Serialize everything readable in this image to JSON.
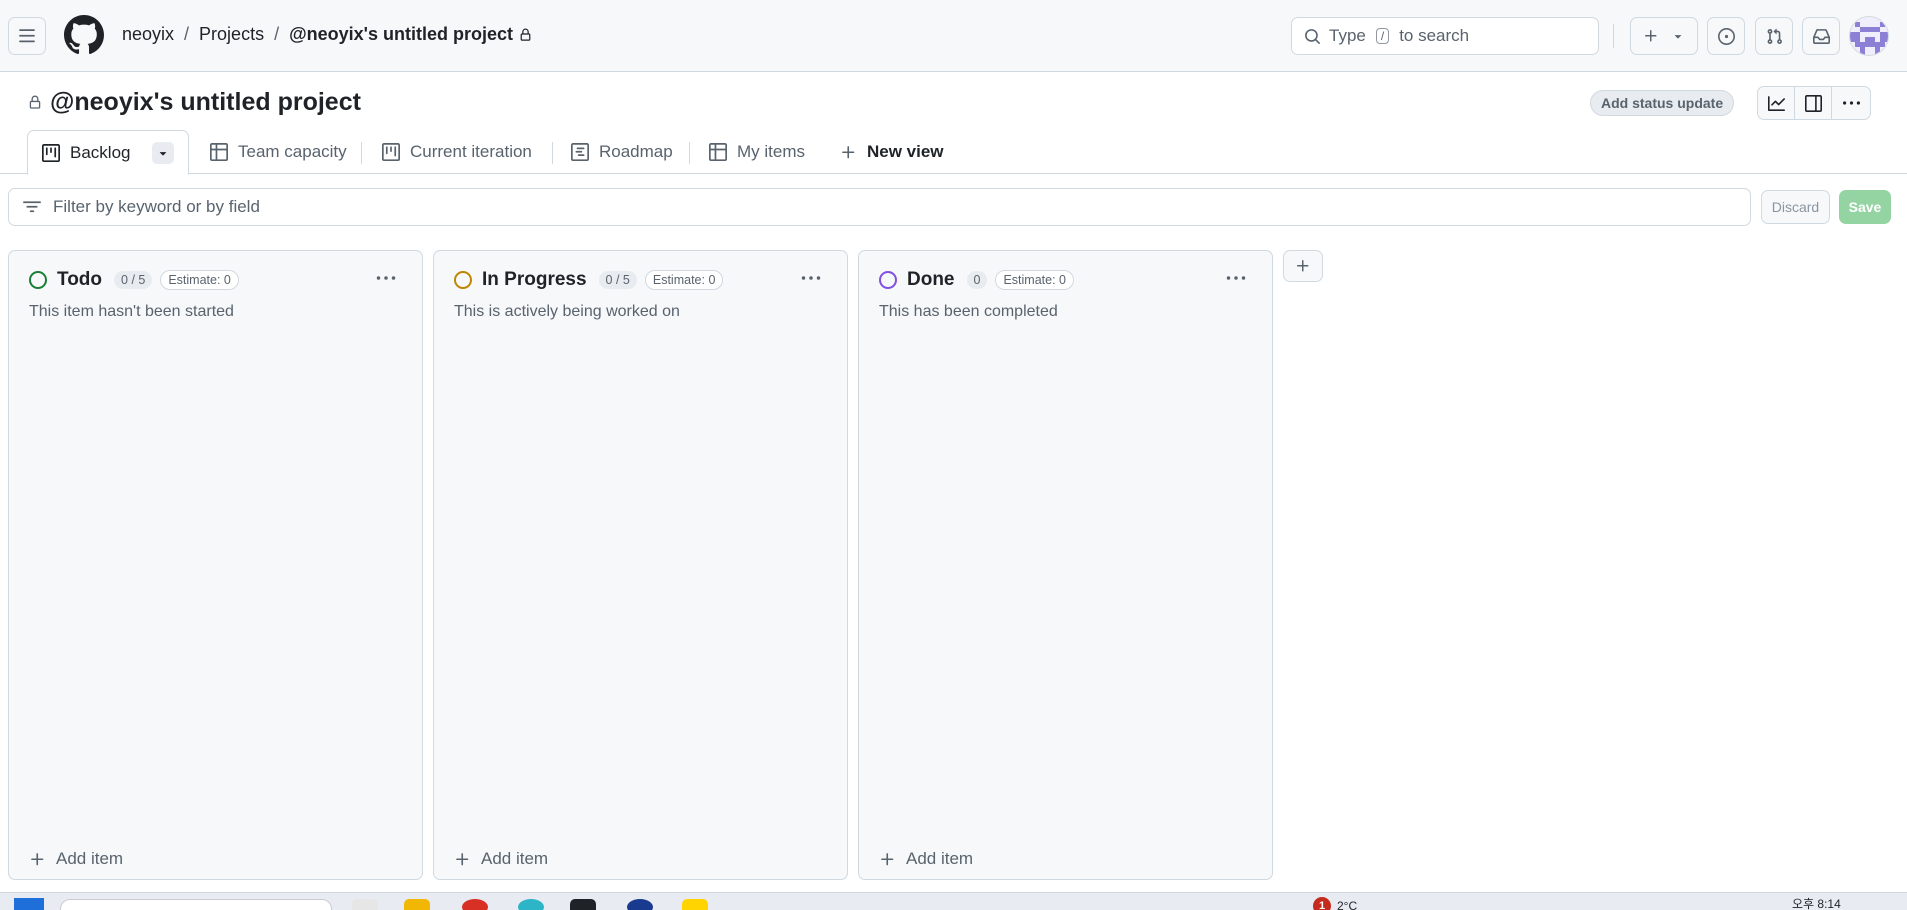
{
  "header": {
    "breadcrumb": {
      "owner": "neoyix",
      "separator": "/",
      "section": "Projects",
      "project": "@neoyix's untitled project"
    },
    "search": {
      "prefix": "Type",
      "key": "/",
      "suffix": "to search"
    },
    "icons": [
      "menu-icon",
      "github-logo-icon",
      "lock-icon",
      "search-icon",
      "plus-icon",
      "triangle-down-icon",
      "issue-opened-icon",
      "git-pull-request-icon",
      "inbox-icon"
    ]
  },
  "project": {
    "title": "@neoyix's untitled project",
    "status_update_label": "Add status update",
    "toolbar_icons": [
      "graph-icon",
      "sidebar-icon",
      "kebab-horizontal-icon"
    ]
  },
  "tabs": {
    "items": [
      {
        "label": "Backlog",
        "icon": "project-board-icon",
        "active": true
      },
      {
        "label": "Team capacity",
        "icon": "table-icon"
      },
      {
        "label": "Current iteration",
        "icon": "project-board-icon"
      },
      {
        "label": "Roadmap",
        "icon": "roadmap-icon"
      },
      {
        "label": "My items",
        "icon": "table-icon"
      }
    ],
    "new_view_label": "New view"
  },
  "filter": {
    "placeholder": "Filter by keyword or by field",
    "discard_label": "Discard",
    "save_label": "Save"
  },
  "board": {
    "columns": [
      {
        "name": "Todo",
        "count": "0 / 5",
        "estimate": "Estimate: 0",
        "description": "This item hasn't been started",
        "color": "#1a7f37"
      },
      {
        "name": "In Progress",
        "count": "0 / 5",
        "estimate": "Estimate: 0",
        "description": "This is actively being worked on",
        "color": "#bf8700"
      },
      {
        "name": "Done",
        "count": "0",
        "estimate": "Estimate: 0",
        "description": "This has been completed",
        "color": "#8250df"
      }
    ],
    "add_item_label": "Add item"
  },
  "taskbar": {
    "notification_count": "1",
    "weather": "2°C",
    "clock": "오후 8:14"
  }
}
